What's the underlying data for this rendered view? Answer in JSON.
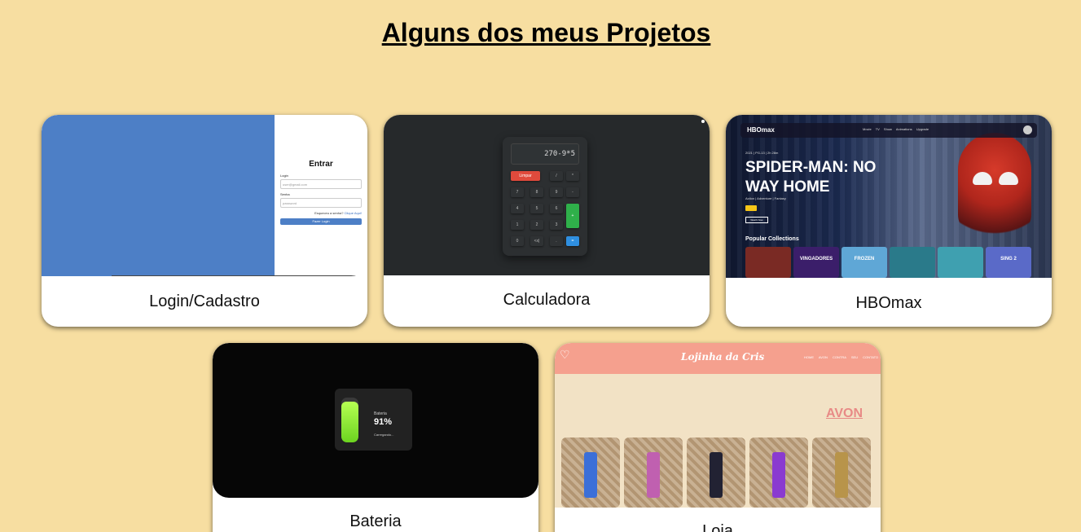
{
  "page": {
    "title": "Alguns dos meus Projetos"
  },
  "projects": [
    {
      "name": "Login/Cadastro"
    },
    {
      "name": "Calculadora"
    },
    {
      "name": "HBOmax"
    },
    {
      "name": "Bateria"
    },
    {
      "name": "Loja"
    }
  ],
  "login_preview": {
    "heading": "Entrar",
    "login_label": "Login",
    "login_placeholder": "user@gmail.com",
    "password_label": "Senha",
    "password_placeholder": "password",
    "forgot_text": "Esqueceu a senha?",
    "forgot_link": "Clique Aqui!",
    "submit_label": "Fazer Login"
  },
  "calc_preview": {
    "display": "270-9*5",
    "buttons": [
      {
        "label": "Limpar",
        "kind": "clear"
      },
      {
        "label": "/",
        "kind": "op"
      },
      {
        "label": "*",
        "kind": "op"
      },
      {
        "label": "7",
        "kind": "num"
      },
      {
        "label": "8",
        "kind": "num"
      },
      {
        "label": "9",
        "kind": "num"
      },
      {
        "label": "-",
        "kind": "op"
      },
      {
        "label": "4",
        "kind": "num"
      },
      {
        "label": "5",
        "kind": "num"
      },
      {
        "label": "6",
        "kind": "num"
      },
      {
        "label": "+",
        "kind": "green"
      },
      {
        "label": "1",
        "kind": "num"
      },
      {
        "label": "2",
        "kind": "num"
      },
      {
        "label": "3",
        "kind": "num"
      },
      {
        "label": "0",
        "kind": "num"
      },
      {
        "label": "<x|",
        "kind": "num"
      },
      {
        "label": ".",
        "kind": "num"
      },
      {
        "label": "=",
        "kind": "blue"
      }
    ]
  },
  "hbo_preview": {
    "logo": "HBOmax",
    "nav_links": "Movie  TV Show  Animations  Upgrade",
    "meta": "2021 | PG-13 | 2h 28m",
    "movie_title": "SPIDER-MAN: NO WAY HOME",
    "genres": "Action | Adventure | Fantasy",
    "watch_label": "Watch Now",
    "popular_heading": "Popular Collections",
    "posters": [
      {
        "title": "",
        "color": "#7a2a24"
      },
      {
        "title": "VINGADORES",
        "color": "#3b1e6a"
      },
      {
        "title": "FROZEN",
        "color": "#5fa7d6"
      },
      {
        "title": "",
        "color": "#2a7a8a"
      },
      {
        "title": "",
        "color": "#3fa0b0"
      },
      {
        "title": "SING 2",
        "color": "#5a6ac8"
      }
    ]
  },
  "battery_preview": {
    "label": "Bateria",
    "percent": "91%",
    "level": 0.91,
    "status": "Carregando..."
  },
  "store_preview": {
    "name": "Lojinha da Cris",
    "nav": "HOME  AVON  CONTRA SEU  CONTATO",
    "brand": "AVON",
    "products": [
      {
        "color": "#3b6fd8"
      },
      {
        "color": "#c060b0"
      },
      {
        "color": "#223"
      },
      {
        "color": "#8a3ad0"
      },
      {
        "color": "#b8944a"
      }
    ]
  }
}
